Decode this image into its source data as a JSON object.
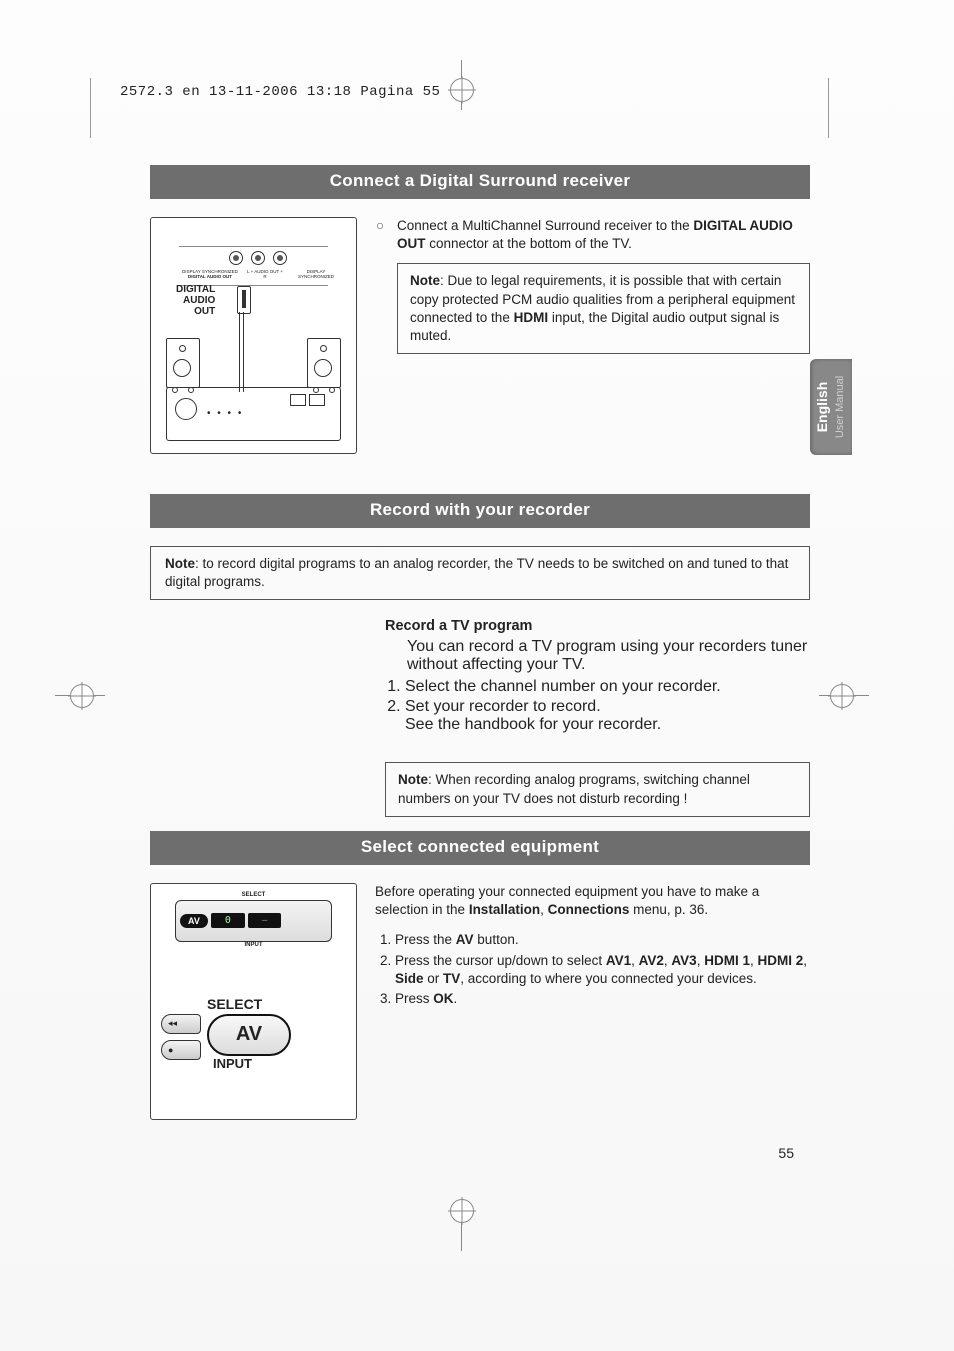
{
  "print_header": "2572.3 en  13-11-2006  13:18  Pagina 55",
  "tab": {
    "language": "English",
    "subtitle": "User Manual"
  },
  "page_number": "55",
  "section1": {
    "title": "Connect a Digital Surround receiver",
    "bullet_marker": "○",
    "bullet_pre": "Connect a MultiChannel Surround receiver to the ",
    "bullet_bold": "DIGITAL AUDIO OUT",
    "bullet_post": " connector at the bottom of the TV.",
    "note_label": "Note",
    "note_pre": ": Due to legal requirements, it is possible that with certain copy protected PCM audio qualities from a peripheral equipment connected to the ",
    "note_bold": "HDMI",
    "note_post": " input, the Digital audio output signal is muted.",
    "figure": {
      "dao_line1": "DIGITAL",
      "dao_line2": "AUDIO",
      "dao_line3": "OUT",
      "panel_left_tiny": "DISPLAY SYNCHRONIZED",
      "panel_dao_tiny": "DIGITAL AUDIO OUT",
      "panel_audio_tiny_l": "L",
      "panel_audio_tiny": "AUDIO OUT",
      "panel_audio_tiny_r": "R",
      "panel_right_tiny": "DISPLAY SYNCHRONIZED"
    }
  },
  "section2": {
    "title": "Record with your recorder",
    "top_note_label": "Note",
    "top_note_text": ": to record digital programs to an analog recorder, the TV needs to be switched on and tuned to that digital programs.",
    "sub_title": "Record a TV program",
    "intro": "You can record a TV program using your recorders tuner without affecting your TV.",
    "step1": "Select the channel number on your recorder.",
    "step2": "Set your recorder to record.",
    "step2_extra": "See the handbook for your recorder.",
    "note2_label": "Note",
    "note2_text": ": When recording analog programs, switching channel numbers on your TV does not disturb recording !"
  },
  "section3": {
    "title": "Select connected equipment",
    "intro_pre": "Before operating your connected equipment you have to make a selection in the ",
    "intro_b1": "Installation",
    "intro_mid1": ", ",
    "intro_b2": "Connections",
    "intro_post": " menu, p. 36.",
    "step1_pre": "Press the ",
    "step1_b": "AV",
    "step1_post": " button.",
    "step2_pre": "Press the cursor up/down to select ",
    "s2_b1": "AV1",
    "s2_c1": ", ",
    "s2_b2": "AV2",
    "s2_c2": ", ",
    "s2_b3": "AV3",
    "s2_c3": ", ",
    "s2_b4": "HDMI 1",
    "s2_c4": ", ",
    "s2_b5": "HDMI 2",
    "s2_c5": ", ",
    "s2_b6": "Side",
    "s2_c6": " or ",
    "s2_b7": "TV",
    "step2_post": ", according to where you connected your devices.",
    "step3_pre": "Press ",
    "step3_b": "OK",
    "step3_post": ".",
    "figure": {
      "select_small": "SELECT",
      "av_small": "AV",
      "digit": "0",
      "dash": "–",
      "input_small": "INPUT",
      "select_large": "SELECT",
      "av_large": "AV",
      "input_large": "INPUT",
      "side_btn1": "◂◂",
      "side_btn2": "●"
    }
  }
}
